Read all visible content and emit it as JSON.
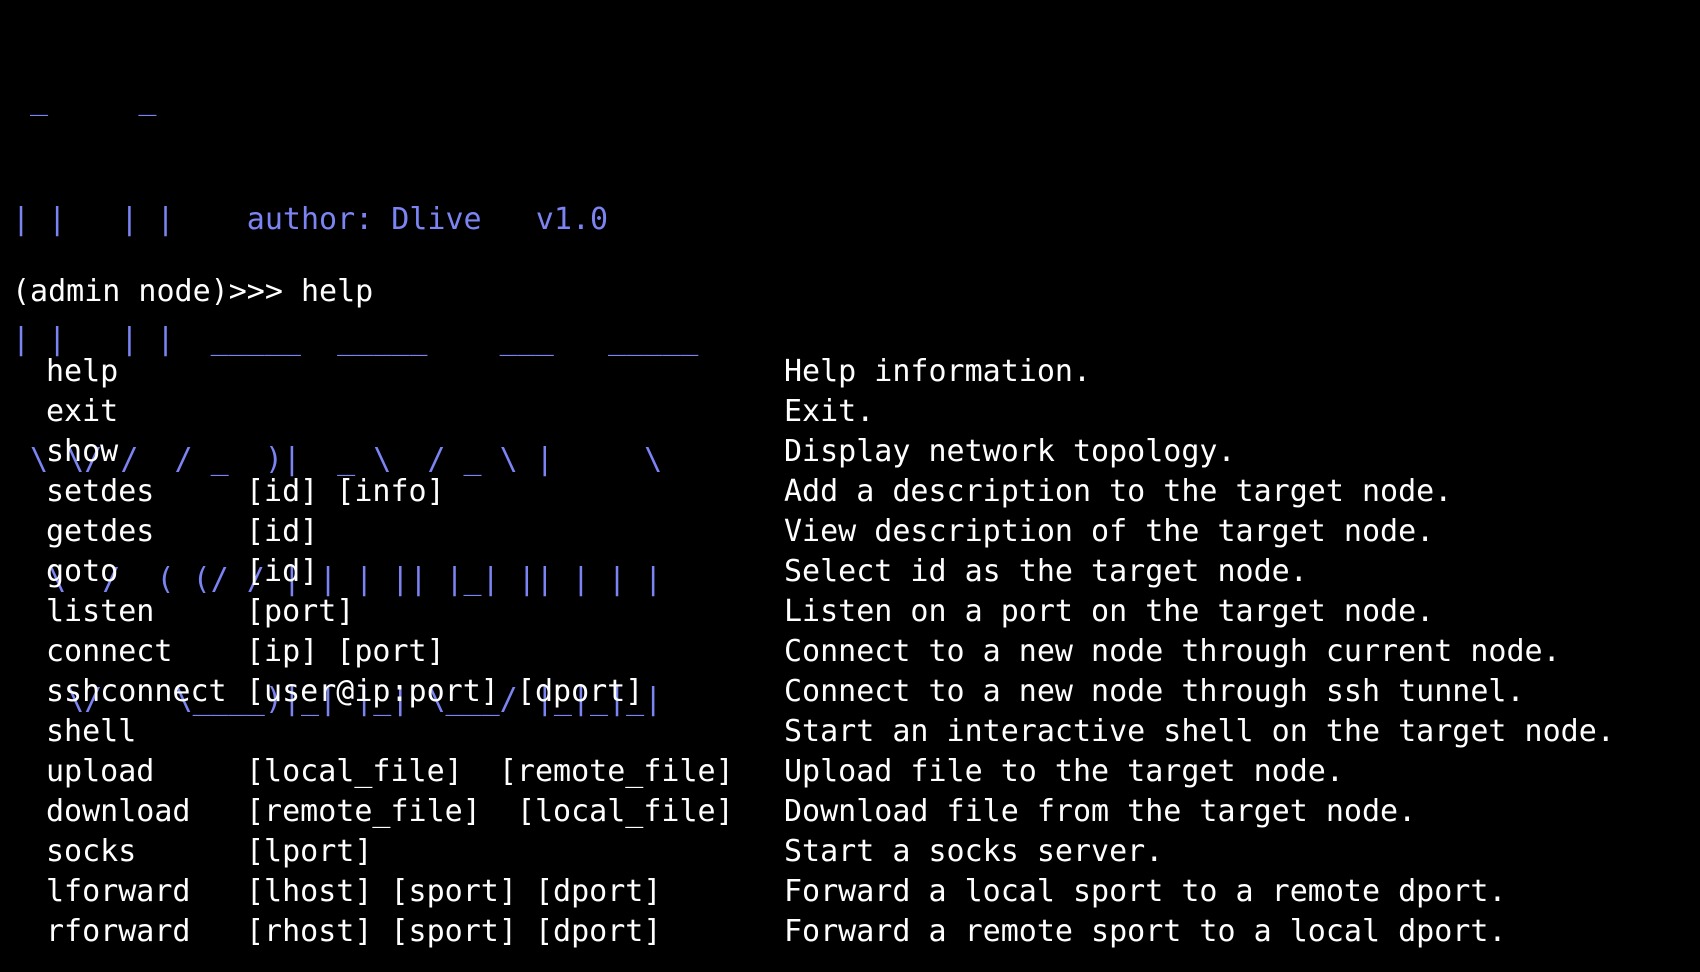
{
  "banner": {
    "lines": [
      " _     _",
      "| |   | |    author: Dlive   v1.0",
      "| |   | |  _____  _____    ___   _____",
      " \\ \\/ /  / _  )|  _ \\  / _ \\ |     \\",
      "  \\  /  ( (/ / | | | || |_| || | | |",
      "   \\/    \\____)|_| |_| \\___/ |_|_|_|"
    ],
    "color": "#7b84f2"
  },
  "prompt": {
    "text": "(admin node)>>> help"
  },
  "help": {
    "rows": [
      {
        "command": "help",
        "args": "",
        "description": "Help information."
      },
      {
        "command": "exit",
        "args": "",
        "description": "Exit."
      },
      {
        "command": "show",
        "args": "",
        "description": "Display network topology."
      },
      {
        "command": "setdes",
        "args": "[id] [info]",
        "description": "Add a description to the target node."
      },
      {
        "command": "getdes",
        "args": "[id]",
        "description": "View description of the target node."
      },
      {
        "command": "goto",
        "args": "[id]",
        "description": "Select id as the target node."
      },
      {
        "command": "listen",
        "args": "[port]",
        "description": "Listen on a port on the target node."
      },
      {
        "command": "connect",
        "args": "[ip] [port]",
        "description": "Connect to a new node through current node."
      },
      {
        "command": "sshconnect",
        "args": "[user@ip:port] [dport]",
        "description": "Connect to a new node through ssh tunnel."
      },
      {
        "command": "shell",
        "args": "",
        "description": "Start an interactive shell on the target node."
      },
      {
        "command": "upload",
        "args": "[local_file]  [remote_file]",
        "description": "Upload file to the target node."
      },
      {
        "command": "download",
        "args": "[remote_file]  [local_file]",
        "description": "Download file from the target node."
      },
      {
        "command": "socks",
        "args": "[lport]",
        "description": "Start a socks server."
      },
      {
        "command": "lforward",
        "args": "[lhost] [sport] [dport]",
        "description": "Forward a local sport to a remote dport."
      },
      {
        "command": "rforward",
        "args": "[rhost] [sport] [dport]",
        "description": "Forward a remote sport to a local dport."
      }
    ]
  }
}
